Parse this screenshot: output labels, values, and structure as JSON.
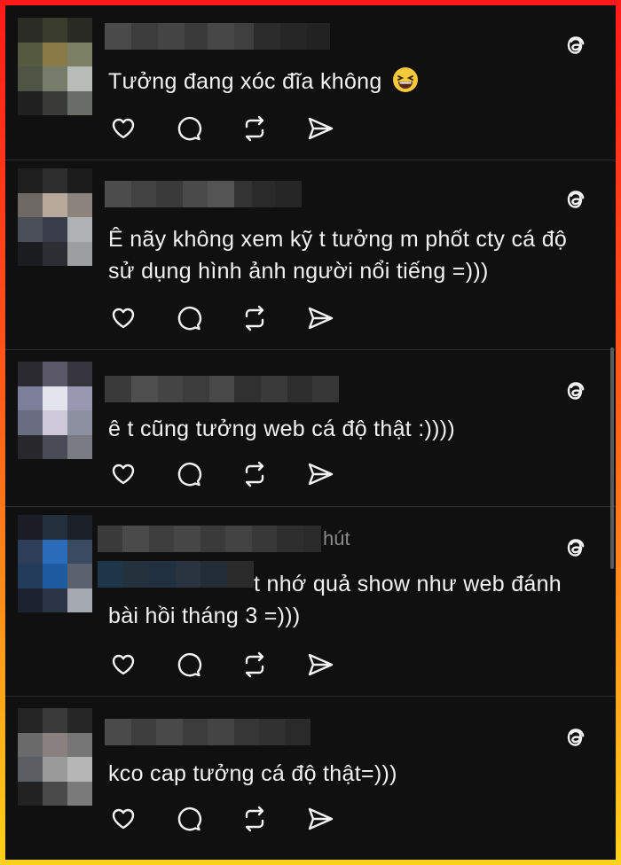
{
  "posts": [
    {
      "text": "Tưởng đang xóc đĩa không",
      "emoji": "grinning-squinting-face"
    },
    {
      "text": "Ê nãy không xem kỹ t tưởng m phốt cty cá độ sử dụng hình ảnh người nổi tiếng =)))"
    },
    {
      "text": "ê t cũng tưởng web cá độ thật :))))"
    },
    {
      "header_suffix": "hút",
      "text": "t nhớ quả show như web đánh bài hồi tháng 3 =)))"
    },
    {
      "text": "kco cap tưởng cá độ thật=)))"
    }
  ],
  "icons": {
    "platform": "threads-logo-icon",
    "like": "heart-icon",
    "reply": "comment-icon",
    "repost": "repost-icon",
    "share": "send-icon"
  },
  "colors": {
    "background": "#101010",
    "text": "#f2f2f2",
    "border_gradient": [
      "#ff1a1a",
      "#ffd21a"
    ]
  }
}
